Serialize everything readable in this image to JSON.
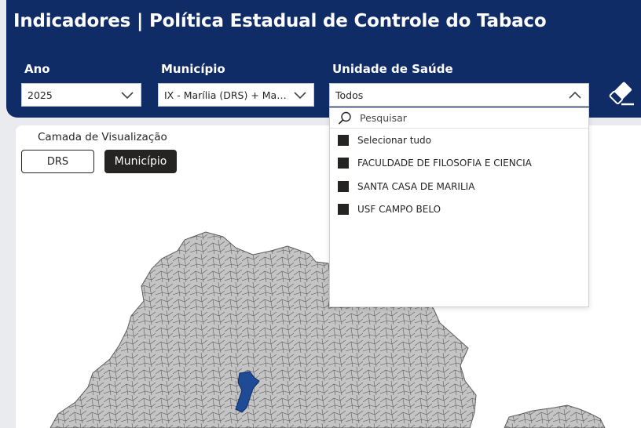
{
  "header": {
    "title": "Indicadores | Política Estadual de Controle do Tabaco"
  },
  "filters": {
    "ano": {
      "label": "Ano",
      "value": "2025"
    },
    "municipio": {
      "label": "Município",
      "value": "IX - Marília (DRS) + Marília"
    },
    "unidade": {
      "label": "Unidade de Saúde",
      "value": "Todos"
    }
  },
  "dropdown": {
    "search_placeholder": "Pesquisar",
    "options": [
      "Selecionar tudo",
      "FACULDADE DE FILOSOFIA E CIENCIA",
      "SANTA CASA DE MARILIA",
      "USF CAMPO BELO"
    ]
  },
  "visual": {
    "layer_label": "Camada de Visualização",
    "buttons": [
      "DRS",
      "Município"
    ],
    "selected": "Município"
  },
  "colors": {
    "header": "#0f2c66",
    "map_fill": "#c4c4c4",
    "map_highlight": "#1f4a96",
    "checkbox": "#252423"
  }
}
